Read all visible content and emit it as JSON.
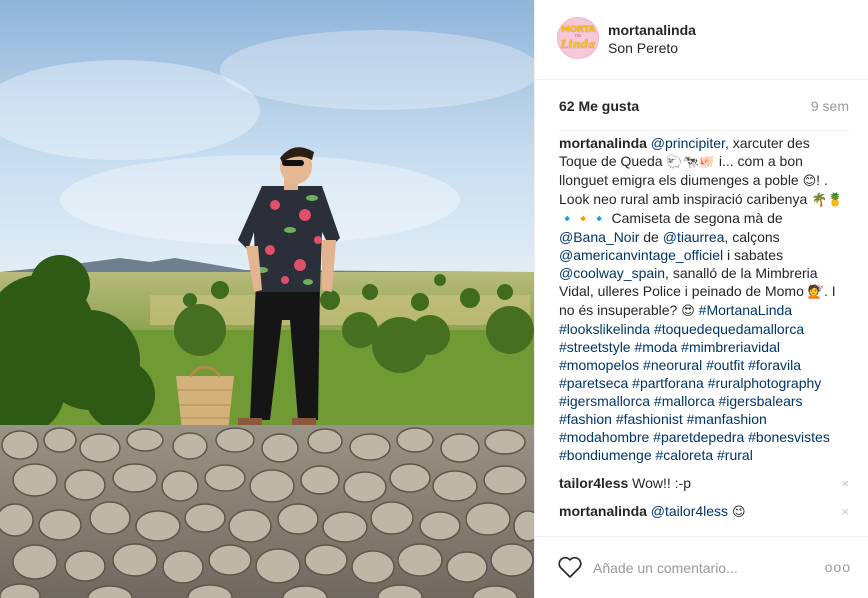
{
  "post": {
    "username": "mortanalinda",
    "location": "Son Pereto",
    "likes": "62 Me gusta",
    "time": "9 sem",
    "avatar": {
      "line1": "MORTA",
      "line2": "na",
      "line3": "Linda"
    }
  },
  "caption": {
    "user": "mortanalinda",
    "mention1": "@principiter",
    "text1": ", xarcuter des Toque de Queda ",
    "emoji1": "🐑🐄🐖",
    "text2": " i... com a bon llonguet emigra els diumenges a poble ",
    "emoji2": "😊",
    "text3": "! . Look neo rural amb inspiració caribenya ",
    "emoji3": "🌴🍍🔹🔸🔹",
    "text4": " Camiseta de segona mà de ",
    "mention2": "@Bana_Noir",
    "text5": " de ",
    "mention3": "@tiaurrea",
    "text6": ", calçons ",
    "mention4": "@americanvintage_officiel",
    "text7": " i sabates ",
    "mention5": "@coolway_spain",
    "text8": ", sanalló de la Mimbreria Vidal, ulleres Police i peinado de Momo ",
    "emoji4": "💇",
    "text9": ". I no és insuperable? ",
    "emoji5": "😍",
    "hashtags": "#MortanaLinda #lookslikelinda #toquedequedamallorca #streetstyle #moda #mimbreriavidal #momopelos #neorural #outfit #foravila #paretseca #partforana #ruralphotography #igersmallorca #mallorca #igersbalears #fashion #fashionist #manfashion #modahombre #paretdepedra #bonesvistes #bondiumenge #caloreta #rural"
  },
  "comments": [
    {
      "user": "tailor4less",
      "text": "Wow!! :-p",
      "mention": "",
      "emoji": "",
      "delete": "×"
    },
    {
      "user": "mortanalinda",
      "text": "",
      "mention": "@tailor4less",
      "emoji": "😉",
      "delete": "×"
    }
  ],
  "footer": {
    "placeholder": "Añade un comentario...",
    "more": "ooo"
  },
  "colors": {
    "link": "#003569",
    "muted": "#999999",
    "border": "#efefef"
  }
}
